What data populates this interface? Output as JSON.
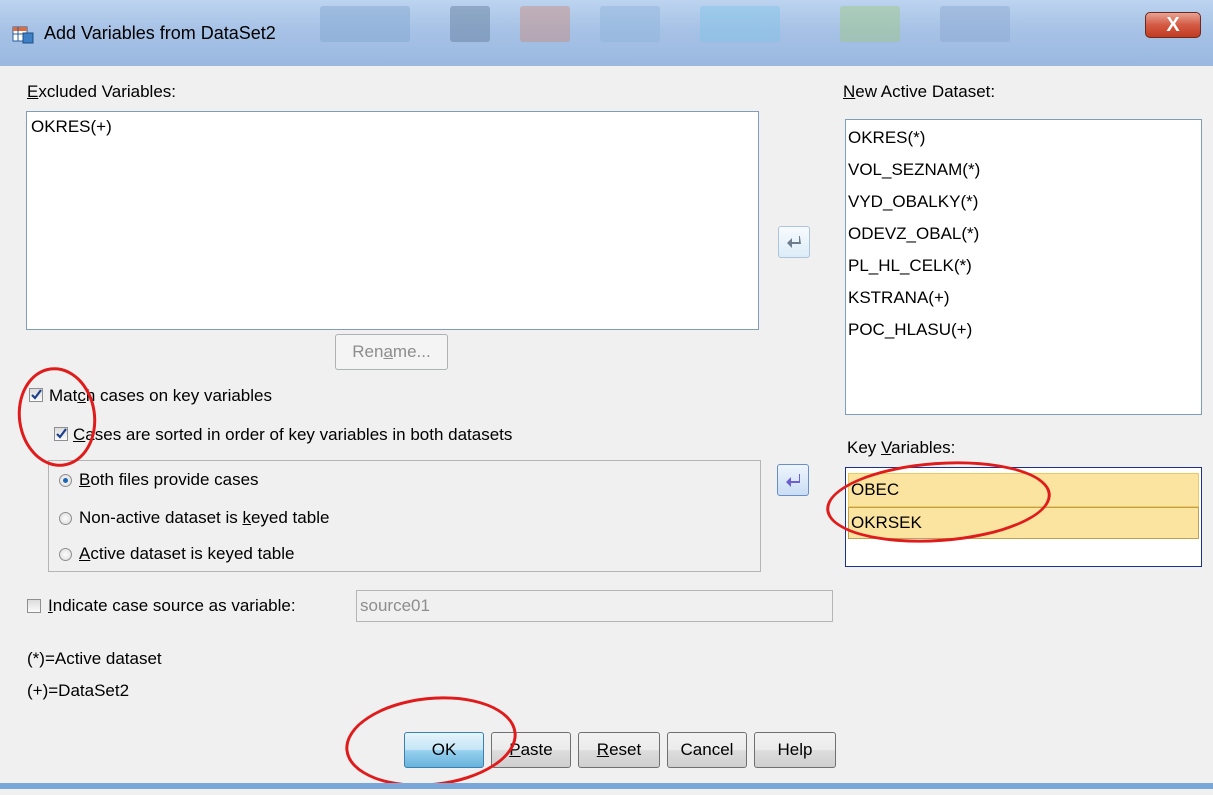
{
  "window": {
    "title": "Add Variables from DataSet2",
    "close_glyph": "X",
    "icon": "spss-dataset-icon"
  },
  "excluded": {
    "label_underline": "E",
    "label_rest": "xcluded Variables:",
    "items": [
      "OKRES(+)"
    ]
  },
  "new_active": {
    "label_underline": "N",
    "label_rest": "ew Active Dataset:",
    "items": [
      "OKRES(*)",
      "VOL_SEZNAM(*)",
      "VYD_OBALKY(*)",
      "ODEVZ_OBAL(*)",
      "PL_HL_CELK(*)",
      "KSTRANA(+)",
      "POC_HLASU(+)"
    ]
  },
  "key_vars": {
    "label_pre": "Key ",
    "label_underline": "V",
    "label_rest": "ariables:",
    "items": [
      "OBEC",
      "OKRSEK"
    ],
    "highlight_color": "#fbe3a0"
  },
  "rename_button": {
    "pre": "Ren",
    "underline": "a",
    "rest": "me..."
  },
  "match_cases": {
    "pre": "Mat",
    "underline": "c",
    "rest": "h cases on key variables",
    "checked": true
  },
  "sorted": {
    "underline": "C",
    "rest": "ases are sorted in order of key variables in both datasets",
    "checked": true
  },
  "radios": [
    {
      "underline": "B",
      "rest": "oth files provide cases",
      "pre": "",
      "selected": true
    },
    {
      "pre": "Non-active dataset is ",
      "underline": "k",
      "rest": "eyed table",
      "selected": false
    },
    {
      "pre": "",
      "underline": "A",
      "rest": "ctive dataset is keyed table",
      "selected": false
    }
  ],
  "indicate": {
    "pre": "",
    "underline": "I",
    "rest": "ndicate case source as variable:",
    "checked": false,
    "value": "source01"
  },
  "legend": {
    "active": "(*)=Active dataset",
    "dataset2": "(+)=DataSet2"
  },
  "buttons": {
    "ok": "OK",
    "paste_underline": "P",
    "paste_rest": "aste",
    "reset_underline": "R",
    "reset_rest": "eset",
    "cancel": "Cancel",
    "help": "Help"
  },
  "colors": {
    "annotation": "#e01b1b",
    "accent": "#3c7fb1"
  }
}
